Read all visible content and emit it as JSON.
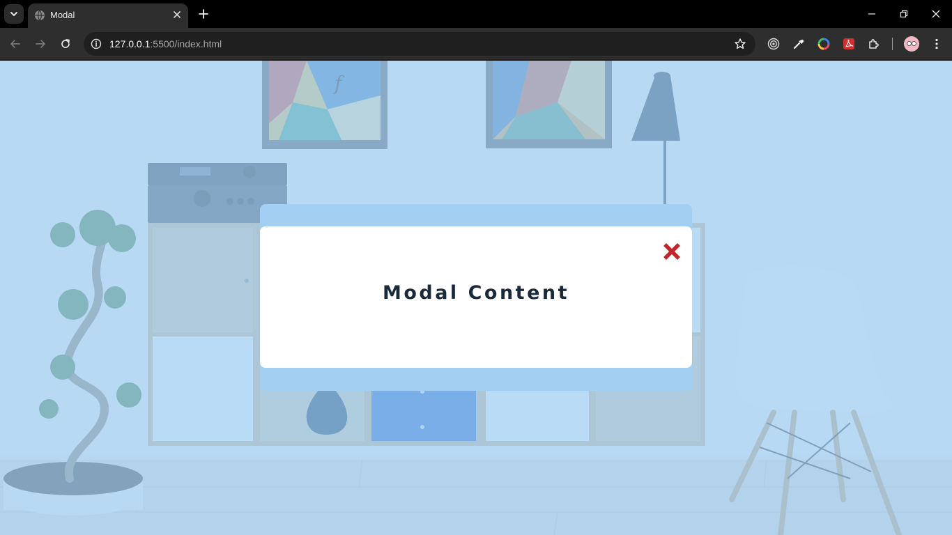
{
  "browser": {
    "tab_title": "Modal",
    "url_host": "127.0.0.1",
    "url_path": ":5500/index.html"
  },
  "modal": {
    "title": "Modal Content",
    "close_color": "#c0262b"
  },
  "colors": {
    "overlay": "#9fcdf2",
    "modal_frame": "#a3d0f2",
    "modal_box": "#ffffff",
    "title_text": "#1b2a3b"
  }
}
